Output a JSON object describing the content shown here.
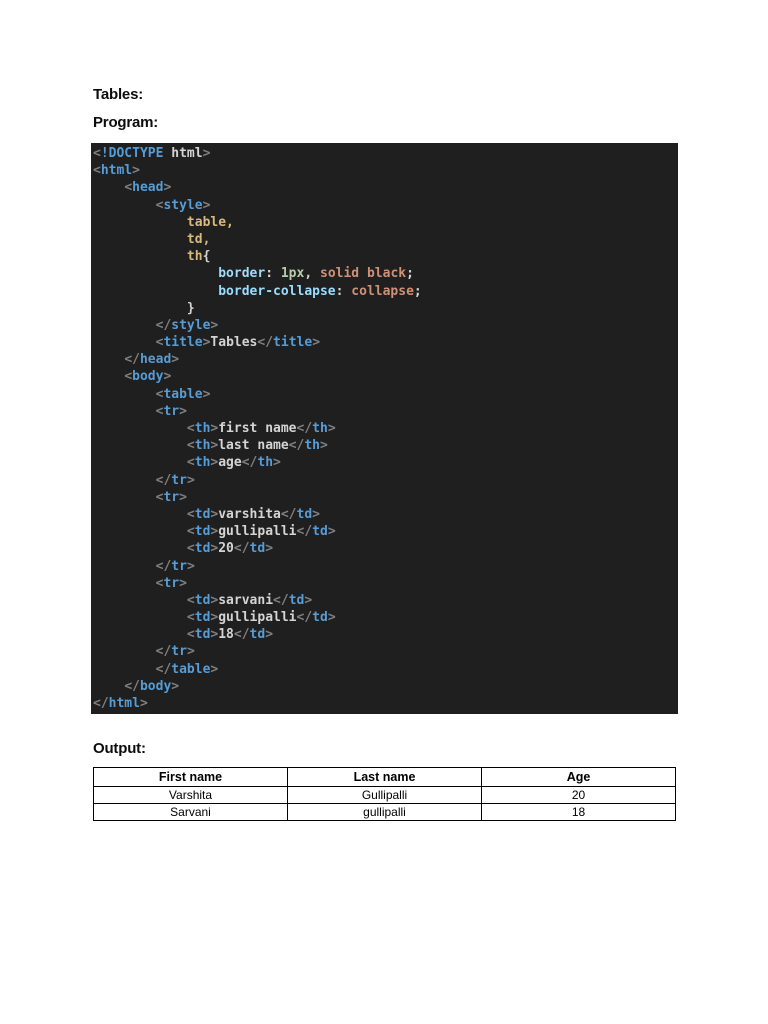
{
  "document": {
    "tables_label": "Tables:",
    "program_label": "Program:",
    "output_label": "Output:"
  },
  "code": {
    "background": "#1f1f1f",
    "token_colors": {
      "punct": "#808080",
      "tag": "#569cd6",
      "text": "#d4d4d4",
      "selector": "#d7ba7d",
      "prop": "#9cdcfe",
      "value": "#ce9178",
      "number": "#b5cea8"
    },
    "lines": [
      [
        {
          "c": "punct",
          "t": "<"
        },
        {
          "c": "tag",
          "t": "!DOCTYPE"
        },
        {
          "c": "text",
          "t": " html"
        },
        {
          "c": "punct",
          "t": ">"
        }
      ],
      [
        {
          "c": "punct",
          "t": "<"
        },
        {
          "c": "tag",
          "t": "html"
        },
        {
          "c": "punct",
          "t": ">"
        }
      ],
      [
        {
          "c": "text",
          "t": "    "
        },
        {
          "c": "punct",
          "t": "<"
        },
        {
          "c": "tag",
          "t": "head"
        },
        {
          "c": "punct",
          "t": ">"
        }
      ],
      [
        {
          "c": "text",
          "t": "        "
        },
        {
          "c": "punct",
          "t": "<"
        },
        {
          "c": "tag",
          "t": "style"
        },
        {
          "c": "punct",
          "t": ">"
        }
      ],
      [
        {
          "c": "text",
          "t": "            "
        },
        {
          "c": "selector",
          "t": "table,"
        }
      ],
      [
        {
          "c": "text",
          "t": "            "
        },
        {
          "c": "selector",
          "t": "td,"
        }
      ],
      [
        {
          "c": "text",
          "t": "            "
        },
        {
          "c": "selector",
          "t": "th"
        },
        {
          "c": "text",
          "t": "{"
        }
      ],
      [
        {
          "c": "text",
          "t": "                "
        },
        {
          "c": "prop",
          "t": "border"
        },
        {
          "c": "text",
          "t": ": "
        },
        {
          "c": "number",
          "t": "1px"
        },
        {
          "c": "text",
          "t": ", "
        },
        {
          "c": "value",
          "t": "solid black"
        },
        {
          "c": "text",
          "t": ";"
        }
      ],
      [
        {
          "c": "text",
          "t": "                "
        },
        {
          "c": "prop",
          "t": "border-collapse"
        },
        {
          "c": "text",
          "t": ": "
        },
        {
          "c": "value",
          "t": "collapse"
        },
        {
          "c": "text",
          "t": ";"
        }
      ],
      [
        {
          "c": "text",
          "t": "            }"
        }
      ],
      [
        {
          "c": "text",
          "t": "        "
        },
        {
          "c": "punct",
          "t": "</"
        },
        {
          "c": "tag",
          "t": "style"
        },
        {
          "c": "punct",
          "t": ">"
        }
      ],
      [
        {
          "c": "text",
          "t": "        "
        },
        {
          "c": "punct",
          "t": "<"
        },
        {
          "c": "tag",
          "t": "title"
        },
        {
          "c": "punct",
          "t": ">"
        },
        {
          "c": "text",
          "t": "Tables"
        },
        {
          "c": "punct",
          "t": "</"
        },
        {
          "c": "tag",
          "t": "title"
        },
        {
          "c": "punct",
          "t": ">"
        }
      ],
      [
        {
          "c": "text",
          "t": "    "
        },
        {
          "c": "punct",
          "t": "</"
        },
        {
          "c": "tag",
          "t": "head"
        },
        {
          "c": "punct",
          "t": ">"
        }
      ],
      [
        {
          "c": "text",
          "t": "    "
        },
        {
          "c": "punct",
          "t": "<"
        },
        {
          "c": "tag",
          "t": "body"
        },
        {
          "c": "punct",
          "t": ">"
        }
      ],
      [
        {
          "c": "text",
          "t": "        "
        },
        {
          "c": "punct",
          "t": "<"
        },
        {
          "c": "tag",
          "t": "table"
        },
        {
          "c": "punct",
          "t": ">"
        }
      ],
      [
        {
          "c": "text",
          "t": "        "
        },
        {
          "c": "punct",
          "t": "<"
        },
        {
          "c": "tag",
          "t": "tr"
        },
        {
          "c": "punct",
          "t": ">"
        }
      ],
      [
        {
          "c": "text",
          "t": "            "
        },
        {
          "c": "punct",
          "t": "<"
        },
        {
          "c": "tag",
          "t": "th"
        },
        {
          "c": "punct",
          "t": ">"
        },
        {
          "c": "text",
          "t": "first name"
        },
        {
          "c": "punct",
          "t": "</"
        },
        {
          "c": "tag",
          "t": "th"
        },
        {
          "c": "punct",
          "t": ">"
        }
      ],
      [
        {
          "c": "text",
          "t": "            "
        },
        {
          "c": "punct",
          "t": "<"
        },
        {
          "c": "tag",
          "t": "th"
        },
        {
          "c": "punct",
          "t": ">"
        },
        {
          "c": "text",
          "t": "last name"
        },
        {
          "c": "punct",
          "t": "</"
        },
        {
          "c": "tag",
          "t": "th"
        },
        {
          "c": "punct",
          "t": ">"
        }
      ],
      [
        {
          "c": "text",
          "t": "            "
        },
        {
          "c": "punct",
          "t": "<"
        },
        {
          "c": "tag",
          "t": "th"
        },
        {
          "c": "punct",
          "t": ">"
        },
        {
          "c": "text",
          "t": "age"
        },
        {
          "c": "punct",
          "t": "</"
        },
        {
          "c": "tag",
          "t": "th"
        },
        {
          "c": "punct",
          "t": ">"
        }
      ],
      [
        {
          "c": "text",
          "t": "        "
        },
        {
          "c": "punct",
          "t": "</"
        },
        {
          "c": "tag",
          "t": "tr"
        },
        {
          "c": "punct",
          "t": ">"
        }
      ],
      [
        {
          "c": "text",
          "t": "        "
        },
        {
          "c": "punct",
          "t": "<"
        },
        {
          "c": "tag",
          "t": "tr"
        },
        {
          "c": "punct",
          "t": ">"
        }
      ],
      [
        {
          "c": "text",
          "t": "            "
        },
        {
          "c": "punct",
          "t": "<"
        },
        {
          "c": "tag",
          "t": "td"
        },
        {
          "c": "punct",
          "t": ">"
        },
        {
          "c": "text",
          "t": "varshita"
        },
        {
          "c": "punct",
          "t": "</"
        },
        {
          "c": "tag",
          "t": "td"
        },
        {
          "c": "punct",
          "t": ">"
        }
      ],
      [
        {
          "c": "text",
          "t": "            "
        },
        {
          "c": "punct",
          "t": "<"
        },
        {
          "c": "tag",
          "t": "td"
        },
        {
          "c": "punct",
          "t": ">"
        },
        {
          "c": "text",
          "t": "gullipalli"
        },
        {
          "c": "punct",
          "t": "</"
        },
        {
          "c": "tag",
          "t": "td"
        },
        {
          "c": "punct",
          "t": ">"
        }
      ],
      [
        {
          "c": "text",
          "t": "            "
        },
        {
          "c": "punct",
          "t": "<"
        },
        {
          "c": "tag",
          "t": "td"
        },
        {
          "c": "punct",
          "t": ">"
        },
        {
          "c": "text",
          "t": "20"
        },
        {
          "c": "punct",
          "t": "</"
        },
        {
          "c": "tag",
          "t": "td"
        },
        {
          "c": "punct",
          "t": ">"
        }
      ],
      [
        {
          "c": "text",
          "t": "        "
        },
        {
          "c": "punct",
          "t": "</"
        },
        {
          "c": "tag",
          "t": "tr"
        },
        {
          "c": "punct",
          "t": ">"
        }
      ],
      [
        {
          "c": "text",
          "t": "        "
        },
        {
          "c": "punct",
          "t": "<"
        },
        {
          "c": "tag",
          "t": "tr"
        },
        {
          "c": "punct",
          "t": ">"
        }
      ],
      [
        {
          "c": "text",
          "t": "            "
        },
        {
          "c": "punct",
          "t": "<"
        },
        {
          "c": "tag",
          "t": "td"
        },
        {
          "c": "punct",
          "t": ">"
        },
        {
          "c": "text",
          "t": "sarvani"
        },
        {
          "c": "punct",
          "t": "</"
        },
        {
          "c": "tag",
          "t": "td"
        },
        {
          "c": "punct",
          "t": ">"
        }
      ],
      [
        {
          "c": "text",
          "t": "            "
        },
        {
          "c": "punct",
          "t": "<"
        },
        {
          "c": "tag",
          "t": "td"
        },
        {
          "c": "punct",
          "t": ">"
        },
        {
          "c": "text",
          "t": "gullipalli"
        },
        {
          "c": "punct",
          "t": "</"
        },
        {
          "c": "tag",
          "t": "td"
        },
        {
          "c": "punct",
          "t": ">"
        }
      ],
      [
        {
          "c": "text",
          "t": "            "
        },
        {
          "c": "punct",
          "t": "<"
        },
        {
          "c": "tag",
          "t": "td"
        },
        {
          "c": "punct",
          "t": ">"
        },
        {
          "c": "text",
          "t": "18"
        },
        {
          "c": "punct",
          "t": "</"
        },
        {
          "c": "tag",
          "t": "td"
        },
        {
          "c": "punct",
          "t": ">"
        }
      ],
      [
        {
          "c": "text",
          "t": "        "
        },
        {
          "c": "punct",
          "t": "</"
        },
        {
          "c": "tag",
          "t": "tr"
        },
        {
          "c": "punct",
          "t": ">"
        }
      ],
      [
        {
          "c": "text",
          "t": "        "
        },
        {
          "c": "punct",
          "t": "</"
        },
        {
          "c": "tag",
          "t": "table"
        },
        {
          "c": "punct",
          "t": ">"
        }
      ],
      [
        {
          "c": "text",
          "t": "    "
        },
        {
          "c": "punct",
          "t": "</"
        },
        {
          "c": "tag",
          "t": "body"
        },
        {
          "c": "punct",
          "t": ">"
        }
      ],
      [
        {
          "c": "punct",
          "t": "</"
        },
        {
          "c": "tag",
          "t": "html"
        },
        {
          "c": "punct",
          "t": ">"
        }
      ]
    ]
  },
  "output_table": {
    "headers": [
      "First name",
      "Last name",
      "Age"
    ],
    "rows": [
      [
        "Varshita",
        "Gullipalli",
        "20"
      ],
      [
        "Sarvani",
        "gullipalli",
        "18"
      ]
    ]
  }
}
